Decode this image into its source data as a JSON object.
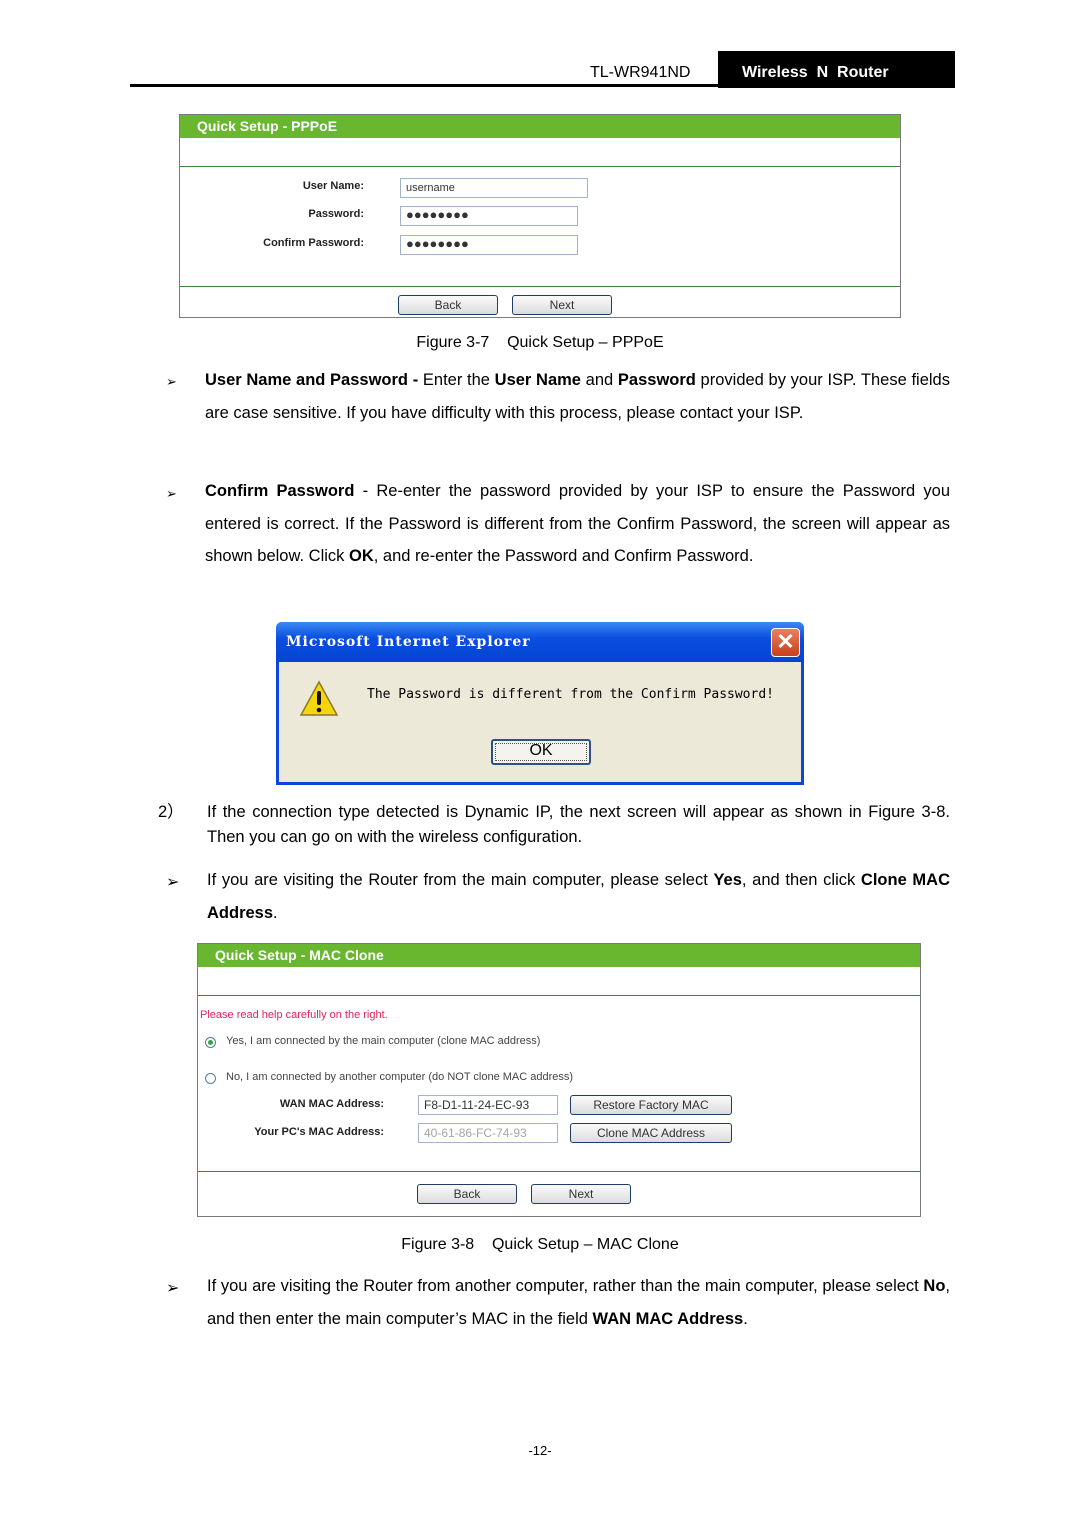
{
  "header": {
    "model": "TL-WR941ND",
    "product": "Wireless  N  Router"
  },
  "pppoe_panel": {
    "title": "Quick Setup - PPPoE",
    "fields": [
      {
        "label": "User Name:",
        "value": "username"
      },
      {
        "label": "Password:",
        "value": "●●●●●●●●"
      },
      {
        "label": "Confirm Password:",
        "value": "●●●●●●●●"
      }
    ],
    "back_label": "Back",
    "next_label": "Next"
  },
  "caption_3_7": "Figure 3-7    Quick Setup – PPPoE",
  "bullets": {
    "b1": {
      "bold1": "User Name and Password -",
      "t1": " Enter the ",
      "bold2": "User Name",
      "t2": " and ",
      "bold3": "Password",
      "t3": " provided by your ISP. These fields are case sensitive. If you have difficulty with this process, please contact your ISP."
    },
    "b2": {
      "bold1": "Confirm Password",
      "t1": " - Re-enter the password provided by your ISP to ensure the Password you entered is correct. If the Password is different from the Confirm Password, the screen will appear as shown below. Click ",
      "bold2": "OK",
      "t2": ", and re-enter the Password and Confirm Password."
    },
    "step2": {
      "number": "2）",
      "text": "If the connection type detected is Dynamic IP, the next screen will appear as shown in Figure 3-8. Then you can go on with the wireless configuration."
    },
    "b3": {
      "t1": "If you are visiting the Router from the main computer, please select ",
      "bold1": "Yes",
      "t2": ", and then click ",
      "bold2": "Clone MAC Address",
      "t3": "."
    },
    "b4": {
      "t1": "If you are visiting the Router from another computer, rather than the main computer, please select ",
      "bold1": "No",
      "t2": ", and then enter the main computer’s MAC in the field ",
      "bold2": "WAN MAC Address",
      "t3": "."
    }
  },
  "dialog": {
    "title": "Microsoft Internet Explorer",
    "message": "The Password is different from the Confirm Password!",
    "ok_label": "OK",
    "close_glyph": "✕"
  },
  "mac_panel": {
    "title": "Quick Setup - MAC Clone",
    "help_text": "Please read help carefully on the right.",
    "help_color": "#e0245e",
    "options": [
      {
        "label": "Yes, I am connected by the main computer (clone MAC address)",
        "selected": true
      },
      {
        "label": "No, I am connected by another computer (do NOT clone MAC address)",
        "selected": false
      }
    ],
    "wan_mac_label": "WAN MAC Address:",
    "wan_mac_value": "F8-D1-11-24-EC-93",
    "restore_label": "Restore Factory MAC",
    "pc_mac_label": "Your PC's MAC Address:",
    "pc_mac_value": "40-61-86-FC-74-93",
    "clone_label": "Clone MAC Address",
    "back_label": "Back",
    "next_label": "Next"
  },
  "caption_3_8": "Figure 3-8    Quick Setup – MAC Clone",
  "bullet_glyph": "➢",
  "page_number": "-12-"
}
